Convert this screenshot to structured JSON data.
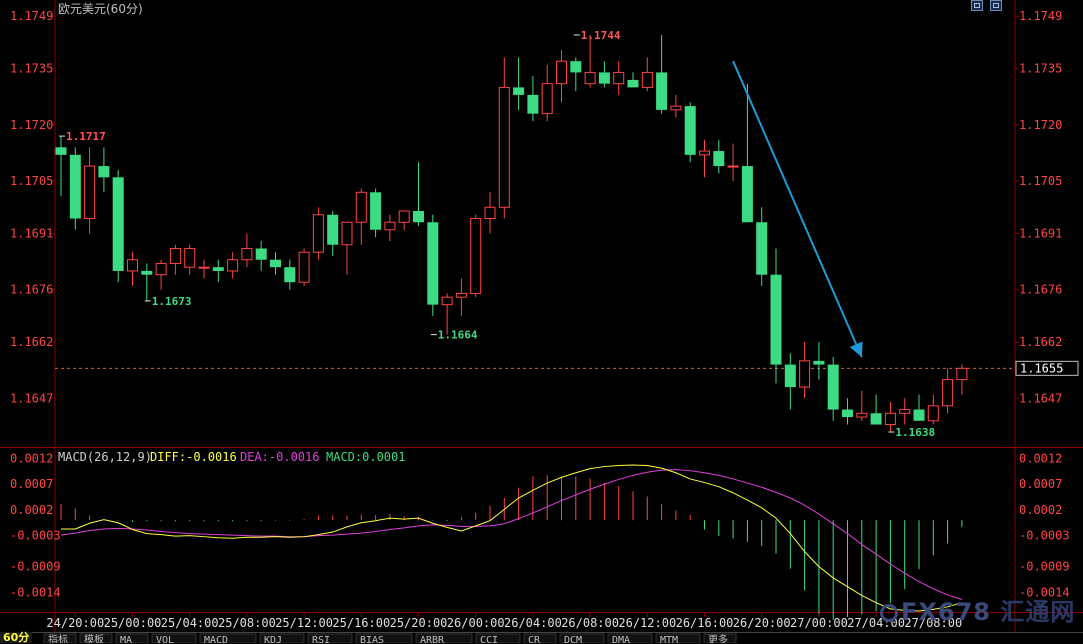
{
  "header": {
    "title": "欧元美元(60分)",
    "macd_label": "MACD(26,12,9)",
    "diff": "DIFF:-0.0016",
    "dea": "DEA:-0.0016",
    "macd": "MACD:0.0001"
  },
  "period_label": "60分",
  "watermark": {
    "brand": "FX678",
    "cn": "汇通网"
  },
  "colors": {
    "up": "#ff4444",
    "down": "#3ddc84",
    "diff_line": "#ffff40",
    "dea_line": "#e040e0",
    "axis_red": "#ff4444",
    "grid_red": "#8b0000",
    "arrow": "#1e9ad6",
    "current_price_line": "#d06020"
  },
  "chart_data": {
    "type": "candlestick",
    "title": "欧元美元(60分)",
    "ylim": [
      1.1634,
      1.1752
    ],
    "y_ticks": [
      "1.1749",
      "1.1735",
      "1.1720",
      "1.1705",
      "1.1691",
      "1.1676",
      "1.1662",
      "1.1647"
    ],
    "x_ticks": [
      "24/20:00",
      "25/00:00",
      "25/04:00",
      "25/08:00",
      "25/12:00",
      "25/16:00",
      "25/20:00",
      "26/00:00",
      "26/04:00",
      "26/08:00",
      "26/12:00",
      "26/16:00",
      "26/20:00",
      "27/00:00",
      "27/04:00",
      "27/08:00"
    ],
    "x_tick_bars": [
      1,
      5,
      9,
      13,
      17,
      21,
      25,
      29,
      33,
      37,
      41,
      45,
      49,
      53,
      57,
      61
    ],
    "current_price": 1.1655,
    "current_price_label": "1.1655",
    "annotations": [
      {
        "bar": 0,
        "price": 1.1717,
        "label": "1.1717",
        "kind": "high"
      },
      {
        "bar": 6,
        "price": 1.1673,
        "label": "1.1673",
        "kind": "low"
      },
      {
        "bar": 26,
        "price": 1.1664,
        "label": "1.1664",
        "kind": "low"
      },
      {
        "bar": 36,
        "price": 1.1744,
        "label": "1.1744",
        "kind": "high"
      },
      {
        "bar": 58,
        "price": 1.1638,
        "label": "1.1638",
        "kind": "low"
      }
    ],
    "trend_arrow": {
      "from": {
        "bar": 47,
        "price": 1.1737
      },
      "to": {
        "bar": 56,
        "price": 1.1658
      }
    },
    "candles": [
      [
        1.1714,
        1.1717,
        1.1701,
        1.1712
      ],
      [
        1.1712,
        1.1714,
        1.1692,
        1.1695
      ],
      [
        1.1695,
        1.1714,
        1.1691,
        1.1709
      ],
      [
        1.1709,
        1.1714,
        1.1702,
        1.1706
      ],
      [
        1.1706,
        1.1708,
        1.1678,
        1.1681
      ],
      [
        1.1681,
        1.1686,
        1.1677,
        1.1684
      ],
      [
        1.1681,
        1.1683,
        1.1673,
        1.168
      ],
      [
        1.168,
        1.1684,
        1.1676,
        1.1683
      ],
      [
        1.1683,
        1.1688,
        1.168,
        1.1687
      ],
      [
        1.1682,
        1.1688,
        1.168,
        1.1687
      ],
      [
        1.1682,
        1.1684,
        1.1679,
        1.1682
      ],
      [
        1.1682,
        1.1684,
        1.1678,
        1.1681
      ],
      [
        1.1681,
        1.1686,
        1.1679,
        1.1684
      ],
      [
        1.1684,
        1.1691,
        1.1682,
        1.1687
      ],
      [
        1.1687,
        1.1689,
        1.1681,
        1.1684
      ],
      [
        1.1684,
        1.1686,
        1.168,
        1.1682
      ],
      [
        1.1682,
        1.1684,
        1.1676,
        1.1678
      ],
      [
        1.1678,
        1.1687,
        1.1677,
        1.1686
      ],
      [
        1.1686,
        1.1698,
        1.1684,
        1.1696
      ],
      [
        1.1696,
        1.1697,
        1.1685,
        1.1688
      ],
      [
        1.1688,
        1.1694,
        1.168,
        1.1694
      ],
      [
        1.1694,
        1.1703,
        1.1688,
        1.1702
      ],
      [
        1.1702,
        1.1703,
        1.169,
        1.1692
      ],
      [
        1.1692,
        1.1696,
        1.1689,
        1.1694
      ],
      [
        1.1694,
        1.1697,
        1.1692,
        1.1697
      ],
      [
        1.1697,
        1.171,
        1.1693,
        1.1694
      ],
      [
        1.1694,
        1.1696,
        1.1669,
        1.1672
      ],
      [
        1.1672,
        1.1675,
        1.1664,
        1.1674
      ],
      [
        1.1674,
        1.1679,
        1.1669,
        1.1675
      ],
      [
        1.1675,
        1.1696,
        1.1674,
        1.1695
      ],
      [
        1.1695,
        1.1702,
        1.1691,
        1.1698
      ],
      [
        1.1698,
        1.1738,
        1.1695,
        1.173
      ],
      [
        1.173,
        1.1738,
        1.1724,
        1.1728
      ],
      [
        1.1728,
        1.1733,
        1.1721,
        1.1723
      ],
      [
        1.1723,
        1.1736,
        1.1721,
        1.1731
      ],
      [
        1.1731,
        1.174,
        1.1726,
        1.1737
      ],
      [
        1.1737,
        1.1738,
        1.1729,
        1.1734
      ],
      [
        1.1731,
        1.1744,
        1.173,
        1.1734
      ],
      [
        1.1734,
        1.1737,
        1.173,
        1.1731
      ],
      [
        1.1731,
        1.1737,
        1.1728,
        1.1734
      ],
      [
        1.1732,
        1.1734,
        1.173,
        1.173
      ],
      [
        1.173,
        1.1738,
        1.1729,
        1.1734
      ],
      [
        1.1734,
        1.1744,
        1.1723,
        1.1724
      ],
      [
        1.1724,
        1.1728,
        1.1722,
        1.1725
      ],
      [
        1.1725,
        1.1726,
        1.171,
        1.1712
      ],
      [
        1.1712,
        1.1716,
        1.1706,
        1.1713
      ],
      [
        1.1713,
        1.1716,
        1.1707,
        1.1709
      ],
      [
        1.1709,
        1.1715,
        1.1705,
        1.1709
      ],
      [
        1.1709,
        1.1731,
        1.1707,
        1.1694
      ],
      [
        1.1694,
        1.1698,
        1.1677,
        1.168
      ],
      [
        1.168,
        1.1687,
        1.1651,
        1.1656
      ],
      [
        1.1656,
        1.1659,
        1.1644,
        1.165
      ],
      [
        1.165,
        1.1662,
        1.1647,
        1.1657
      ],
      [
        1.1657,
        1.1662,
        1.1652,
        1.1656
      ],
      [
        1.1656,
        1.1658,
        1.1641,
        1.1644
      ],
      [
        1.1644,
        1.1647,
        1.164,
        1.1642
      ],
      [
        1.1642,
        1.1649,
        1.1641,
        1.1643
      ],
      [
        1.1643,
        1.1648,
        1.164,
        1.164
      ],
      [
        1.164,
        1.1646,
        1.1638,
        1.1643
      ],
      [
        1.1643,
        1.1647,
        1.164,
        1.1644
      ],
      [
        1.1644,
        1.1648,
        1.1641,
        1.1641
      ],
      [
        1.1641,
        1.1648,
        1.164,
        1.1645
      ],
      [
        1.1645,
        1.1655,
        1.1643,
        1.1652
      ],
      [
        1.1652,
        1.1656,
        1.1648,
        1.1655
      ]
    ],
    "macd": {
      "ylim": [
        -0.0018,
        0.0014
      ],
      "y_ticks": [
        "0.0012",
        "0.0007",
        "0.0002",
        "-0.0003",
        "-0.0009",
        "-0.0014"
      ],
      "diff": [
        -0.00017,
        -0.00017,
        -6e-05,
        1e-05,
        -5e-05,
        -0.00018,
        -0.00026,
        -0.00028,
        -0.00031,
        -0.0003,
        -0.00032,
        -0.00034,
        -0.00035,
        -0.00033,
        -0.00033,
        -0.00032,
        -0.00033,
        -0.00032,
        -0.00028,
        -0.00023,
        -0.00013,
        -5e-05,
        -1e-05,
        4e-05,
        2e-05,
        4e-05,
        -6e-05,
        -0.00014,
        -0.00021,
        -0.00011,
        -1e-05,
        0.00021,
        0.00043,
        0.00058,
        0.00072,
        0.00083,
        0.00092,
        0.001,
        0.00104,
        0.00106,
        0.00107,
        0.00106,
        0.00101,
        0.00092,
        0.0008,
        0.00073,
        0.00065,
        0.00053,
        0.00039,
        0.00024,
        4e-05,
        -0.00026,
        -0.00061,
        -0.0009,
        -0.00112,
        -0.00129,
        -0.00146,
        -0.0016,
        -0.00172,
        -0.00175,
        -0.00176,
        -0.00173,
        -0.00168,
        -0.0016
      ],
      "dea": [
        -0.00029,
        -0.00025,
        -0.0002,
        -0.00017,
        -0.00016,
        -0.00017,
        -0.00019,
        -0.00022,
        -0.00024,
        -0.00026,
        -0.00027,
        -0.00028,
        -0.00029,
        -0.0003,
        -0.00031,
        -0.00031,
        -0.00032,
        -0.00032,
        -0.0003,
        -0.00029,
        -0.00027,
        -0.00025,
        -0.00022,
        -0.00018,
        -0.00015,
        -0.00011,
        -9e-05,
        -0.0001,
        -0.00012,
        -0.00012,
        -0.00011,
        -7e-05,
        3e-05,
        0.00014,
        0.00026,
        0.00038,
        0.00049,
        0.0006,
        0.0007,
        0.00079,
        0.00087,
        0.00093,
        0.00097,
        0.00098,
        0.00096,
        0.00092,
        0.00087,
        0.0008,
        0.00072,
        0.00064,
        0.00054,
        0.00043,
        0.00029,
        0.00012,
        -7e-05,
        -0.00026,
        -0.00047,
        -0.00066,
        -0.00085,
        -0.00103,
        -0.00119,
        -0.00133,
        -0.00145,
        -0.00154
      ],
      "hist": [
        0.00032,
        0.00023,
        9e-05,
        1e-05,
        -1e-05,
        -4e-05,
        -2e-05,
        -2e-05,
        -2e-05,
        -2e-05,
        -2e-05,
        -2e-05,
        -2e-05,
        -2e-05,
        -2e-05,
        -1e-05,
        -1e-05,
        2e-05,
        9e-05,
        9e-05,
        9e-05,
        0.00011,
        0.0001,
        0.00012,
        8e-05,
        6e-05,
        -1e-05,
        -2e-05,
        6e-05,
        0.00014,
        0.00028,
        0.00043,
        0.00063,
        0.00085,
        0.00087,
        0.00083,
        0.00085,
        0.00081,
        0.00072,
        0.00066,
        0.00056,
        0.00046,
        0.00031,
        0.00019,
        0.0001,
        -0.00018,
        -0.00031,
        -0.00035,
        -0.00042,
        -0.0005,
        -0.00065,
        -0.00094,
        -0.00136,
        -0.00182,
        -0.00194,
        -0.00188,
        -0.00183,
        -0.00177,
        -0.00161,
        -0.00134,
        -0.00095,
        -0.00068,
        -0.00045,
        -0.00013
      ]
    }
  },
  "bottom_tabs": [
    "指标",
    "模板",
    "MA",
    "VOL",
    "MACD",
    "KDJ",
    "RSI",
    "BIAS",
    "ARBR",
    "CCI",
    "CR",
    "DCM",
    "DMA",
    "MTM",
    "更多"
  ]
}
